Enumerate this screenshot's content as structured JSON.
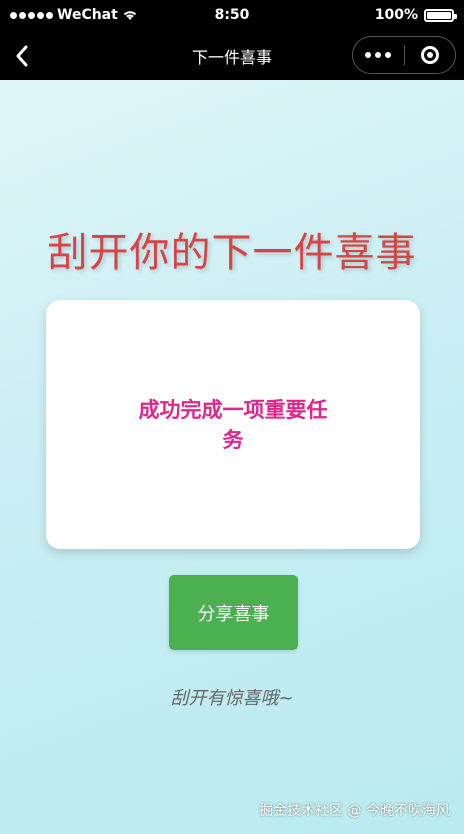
{
  "status_bar": {
    "carrier": "WeChat",
    "time": "8:50",
    "battery": "100%",
    "battery_level": 1.0
  },
  "nav": {
    "title": "下一件喜事"
  },
  "main": {
    "headline": "刮开你的下一件喜事",
    "card_text": "成功完成一项重要任务",
    "share_label": "分享喜事",
    "hint": "刮开有惊喜哦~"
  },
  "watermark": "掘金技术社区 @ 今晚不吹海风",
  "colors": {
    "headline": "#d64545",
    "card_text": "#e0258b",
    "share_button": "#4caf50",
    "background": "#c9eef3"
  }
}
